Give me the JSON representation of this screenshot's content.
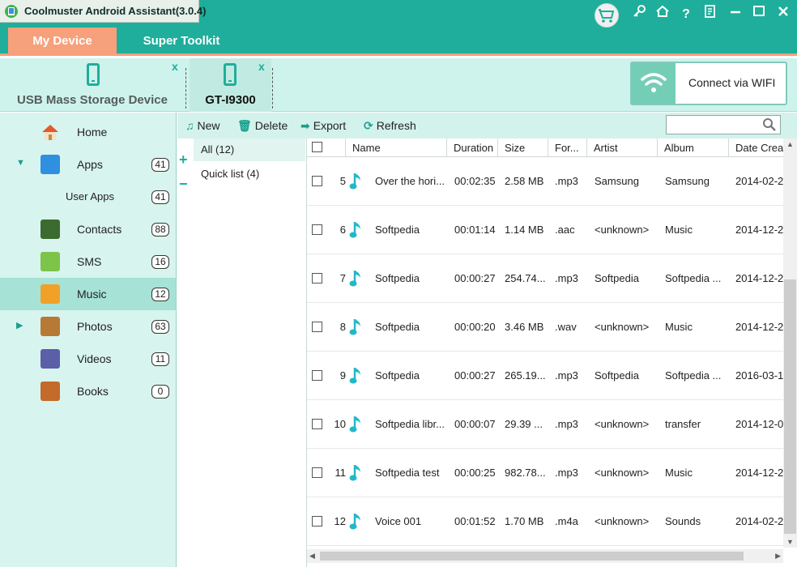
{
  "window": {
    "title": "Coolmuster Android Assistant(3.0.4)",
    "icons": [
      "cart-icon",
      "key-icon",
      "home-icon",
      "help-icon",
      "feedback-icon",
      "minimize-icon",
      "maximize-icon",
      "close-icon"
    ]
  },
  "menu": {
    "tabs": [
      {
        "label": "My Device",
        "active": true
      },
      {
        "label": "Super Toolkit",
        "active": false
      }
    ]
  },
  "devices": [
    {
      "label": "USB Mass Storage Device",
      "active": false
    },
    {
      "label": "GT-I9300",
      "active": true
    }
  ],
  "device_close": "x",
  "wifi": {
    "label": "Connect via WIFI"
  },
  "sidebar": {
    "items": [
      {
        "label": "Home",
        "count": ""
      },
      {
        "label": "Apps",
        "count": "41"
      },
      {
        "label": "User Apps",
        "count": "41"
      },
      {
        "label": "Contacts",
        "count": "88"
      },
      {
        "label": "SMS",
        "count": "16"
      },
      {
        "label": "Music",
        "count": "12"
      },
      {
        "label": "Photos",
        "count": "63"
      },
      {
        "label": "Videos",
        "count": "11"
      },
      {
        "label": "Books",
        "count": "0"
      }
    ]
  },
  "toolbar": {
    "new_label": "New",
    "delete_label": "Delete",
    "export_label": "Export",
    "refresh_label": "Refresh",
    "search_value": ""
  },
  "playlists": {
    "add_symbol": "+",
    "remove_symbol": "−",
    "items": [
      {
        "label": "All (12)",
        "active": true
      },
      {
        "label": "Quick list (4)",
        "active": false
      }
    ]
  },
  "table": {
    "columns": [
      "",
      "Name",
      "Duration",
      "Size",
      "For...",
      "Artist",
      "Album",
      "Date Crea"
    ],
    "rows": [
      {
        "num": "5",
        "name": "Over the hori...",
        "duration": "00:02:35",
        "size": "2.58 MB",
        "format": ".mp3",
        "artist": "Samsung",
        "album": "Samsung",
        "date": "2014-02-2"
      },
      {
        "num": "6",
        "name": "Softpedia",
        "duration": "00:01:14",
        "size": "1.14 MB",
        "format": ".aac",
        "artist": "<unknown>",
        "album": "Music",
        "date": "2014-12-2"
      },
      {
        "num": "7",
        "name": "Softpedia",
        "duration": "00:00:27",
        "size": "254.74...",
        "format": ".mp3",
        "artist": "Softpedia",
        "album": "Softpedia ...",
        "date": "2014-12-2"
      },
      {
        "num": "8",
        "name": "Softpedia",
        "duration": "00:00:20",
        "size": "3.46 MB",
        "format": ".wav",
        "artist": "<unknown>",
        "album": "Music",
        "date": "2014-12-2"
      },
      {
        "num": "9",
        "name": "Softpedia",
        "duration": "00:00:27",
        "size": "265.19...",
        "format": ".mp3",
        "artist": "Softpedia",
        "album": "Softpedia ...",
        "date": "2016-03-1"
      },
      {
        "num": "10",
        "name": "Softpedia libr...",
        "duration": "00:00:07",
        "size": "29.39 ...",
        "format": ".mp3",
        "artist": "<unknown>",
        "album": "transfer",
        "date": "2014-12-0"
      },
      {
        "num": "11",
        "name": "Softpedia test",
        "duration": "00:00:25",
        "size": "982.78...",
        "format": ".mp3",
        "artist": "<unknown>",
        "album": "Music",
        "date": "2014-12-2"
      },
      {
        "num": "12",
        "name": "Voice 001",
        "duration": "00:01:52",
        "size": "1.70 MB",
        "format": ".m4a",
        "artist": "<unknown>",
        "album": "Sounds",
        "date": "2014-02-2"
      }
    ]
  },
  "colors": {
    "accent": "#1fae9b",
    "active_tab": "#f7a07c",
    "sidebar_bg": "#d8f4ef",
    "sidebar_active": "#a6e2d6"
  }
}
